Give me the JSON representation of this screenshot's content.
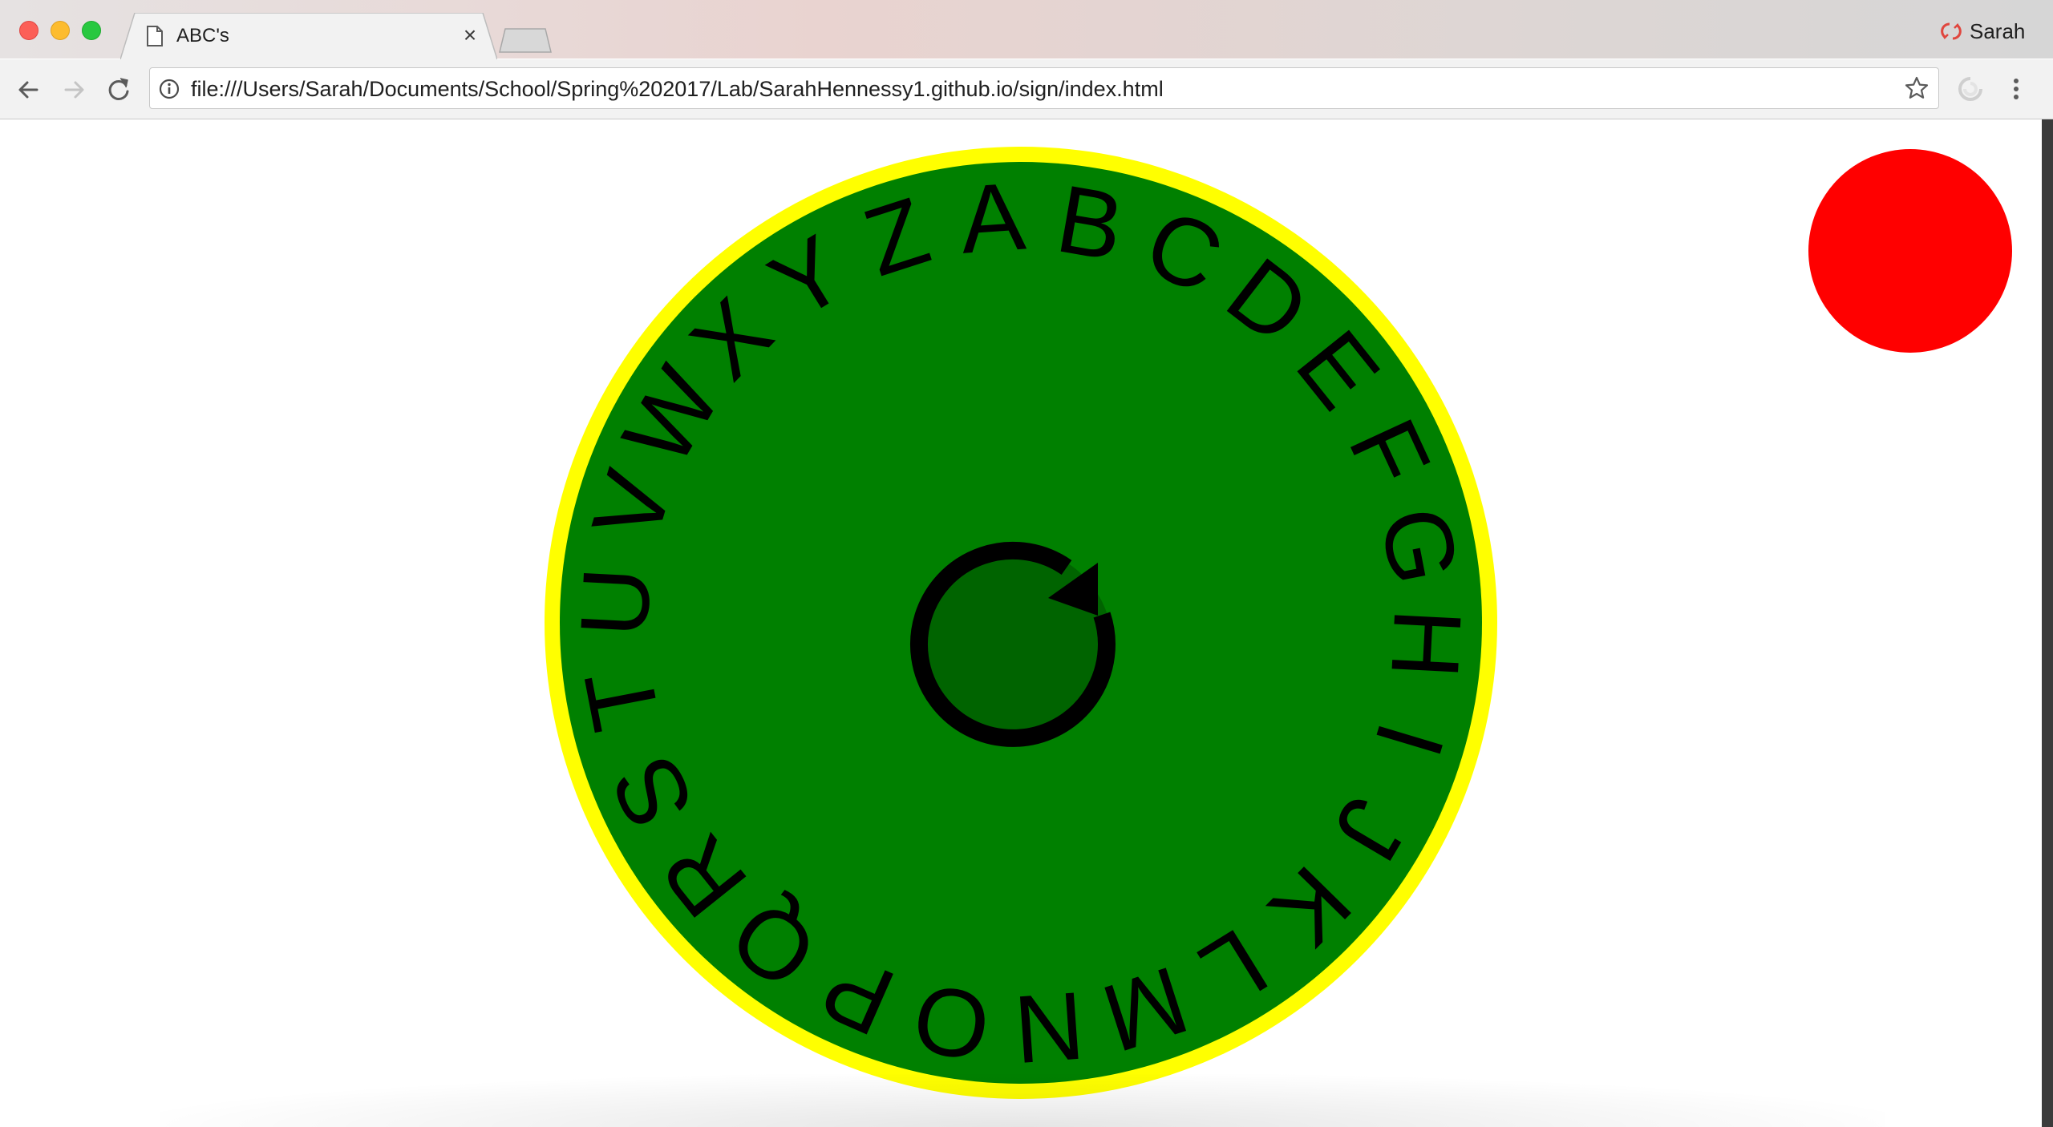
{
  "browser": {
    "tab": {
      "title": "ABC's",
      "close_glyph": "×"
    },
    "profile": {
      "name": "Sarah",
      "icon": "sync-error-icon"
    },
    "address_bar": {
      "url": "file:///Users/Sarah/Documents/School/Spring%202017/Lab/SarahHennessy1.github.io/sign/index.html"
    },
    "nav": {
      "back_icon": "arrow-left-icon",
      "forward_icon": "arrow-right-icon",
      "reload_icon": "reload-icon"
    },
    "window_controls": [
      "close",
      "minimize",
      "maximize"
    ]
  },
  "page": {
    "dial": {
      "letters": [
        "A",
        "B",
        "C",
        "D",
        "E",
        "F",
        "G",
        "H",
        "I",
        "J",
        "K",
        "L",
        "M",
        "N",
        "O",
        "P",
        "Q",
        "R",
        "S",
        "T",
        "U",
        "V",
        "W",
        "X",
        "Y",
        "Z"
      ],
      "center_icon": "rotate-icon",
      "colors": {
        "outer_ring": "#ffff00",
        "face": "#008000",
        "center_button": "#006400",
        "letters": "#000000"
      }
    },
    "indicator": {
      "color": "#ff0000"
    }
  }
}
